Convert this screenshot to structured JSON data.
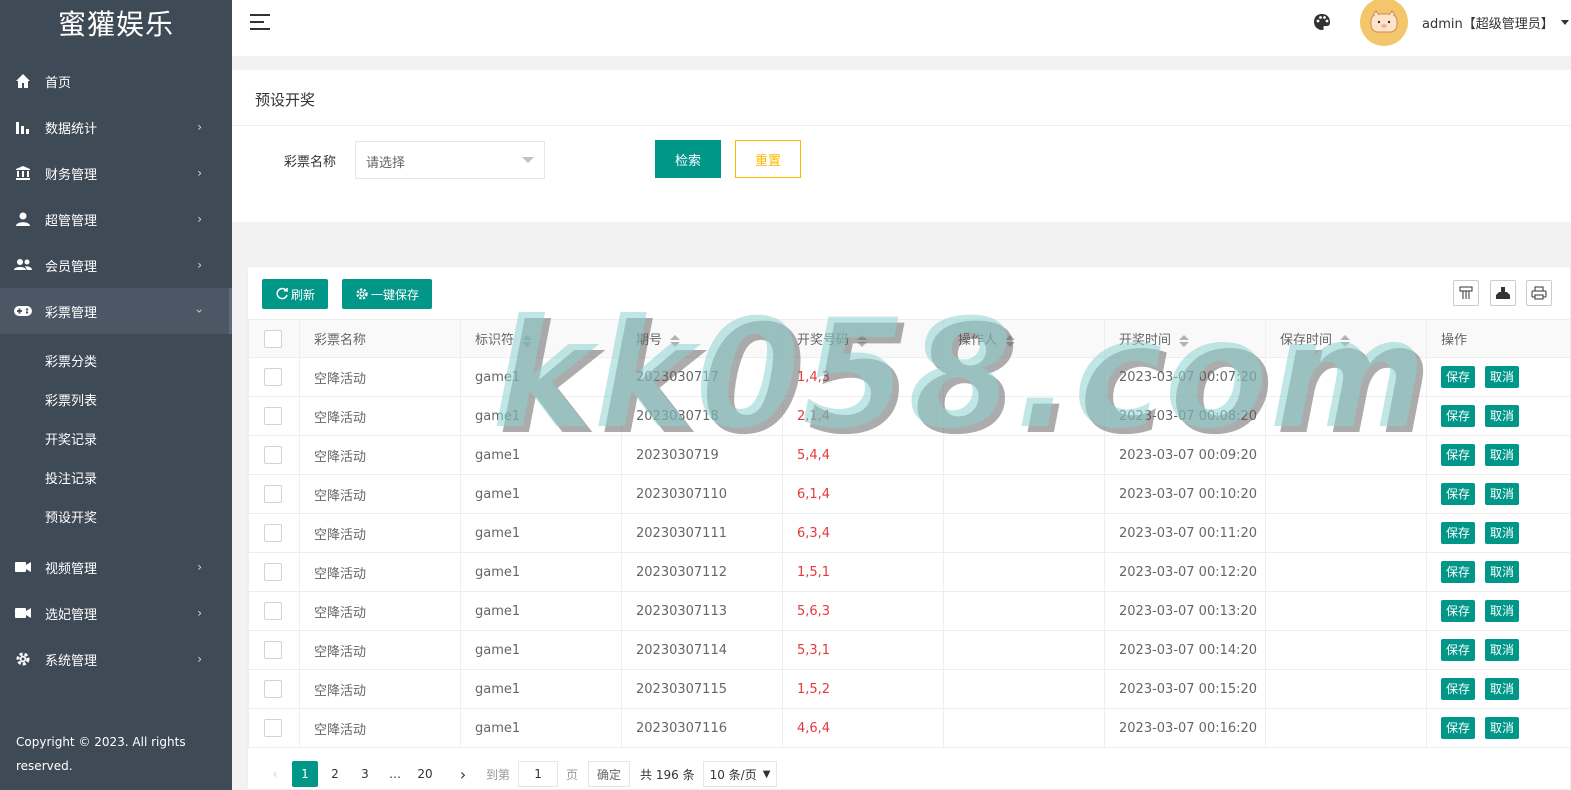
{
  "app": {
    "logo": "蜜獾娱乐",
    "copyright": "Copyright © 2023. All rights reserved."
  },
  "sidebar": {
    "items": [
      {
        "label": "首页",
        "icon": "home-icon"
      },
      {
        "label": "数据统计",
        "icon": "bar-chart-icon"
      },
      {
        "label": "财务管理",
        "icon": "bank-icon"
      },
      {
        "label": "超管管理",
        "icon": "user-icon"
      },
      {
        "label": "会员管理",
        "icon": "users-icon"
      },
      {
        "label": "彩票管理",
        "icon": "gamepad-icon",
        "expanded": true
      },
      {
        "label": "视频管理",
        "icon": "video-icon"
      },
      {
        "label": "选妃管理",
        "icon": "video-icon"
      },
      {
        "label": "系统管理",
        "icon": "gear-icon"
      }
    ],
    "sub_items": [
      "彩票分类",
      "彩票列表",
      "开奖记录",
      "投注记录",
      "预设开奖"
    ]
  },
  "header": {
    "user": "admin【超级管理员】"
  },
  "panel": {
    "title": "预设开奖",
    "field_label": "彩票名称",
    "select_placeholder": "请选择",
    "search_label": "检索",
    "reset_label": "重置"
  },
  "toolbar": {
    "refresh_label": "刷新",
    "save_all_label": "一键保存"
  },
  "table": {
    "columns": [
      "彩票名称",
      "标识符",
      "期号",
      "开奖号码",
      "操作人",
      "开奖时间",
      "保存时间",
      "操作"
    ],
    "save_label": "保存",
    "cancel_label": "取消",
    "rows": [
      {
        "name": "空降活动",
        "key": "game1",
        "issue": "2023030717",
        "numbers": "1,4,3",
        "operator": "",
        "draw_time": "2023-03-07 00:07:20",
        "save_time": ""
      },
      {
        "name": "空降活动",
        "key": "game1",
        "issue": "2023030718",
        "numbers": "2,1,4",
        "operator": "",
        "draw_time": "2023-03-07 00:08:20",
        "save_time": ""
      },
      {
        "name": "空降活动",
        "key": "game1",
        "issue": "2023030719",
        "numbers": "5,4,4",
        "operator": "",
        "draw_time": "2023-03-07 00:09:20",
        "save_time": ""
      },
      {
        "name": "空降活动",
        "key": "game1",
        "issue": "20230307110",
        "numbers": "6,1,4",
        "operator": "",
        "draw_time": "2023-03-07 00:10:20",
        "save_time": ""
      },
      {
        "name": "空降活动",
        "key": "game1",
        "issue": "20230307111",
        "numbers": "6,3,4",
        "operator": "",
        "draw_time": "2023-03-07 00:11:20",
        "save_time": ""
      },
      {
        "name": "空降活动",
        "key": "game1",
        "issue": "20230307112",
        "numbers": "1,5,1",
        "operator": "",
        "draw_time": "2023-03-07 00:12:20",
        "save_time": ""
      },
      {
        "name": "空降活动",
        "key": "game1",
        "issue": "20230307113",
        "numbers": "5,6,3",
        "operator": "",
        "draw_time": "2023-03-07 00:13:20",
        "save_time": ""
      },
      {
        "name": "空降活动",
        "key": "game1",
        "issue": "20230307114",
        "numbers": "5,3,1",
        "operator": "",
        "draw_time": "2023-03-07 00:14:20",
        "save_time": ""
      },
      {
        "name": "空降活动",
        "key": "game1",
        "issue": "20230307115",
        "numbers": "1,5,2",
        "operator": "",
        "draw_time": "2023-03-07 00:15:20",
        "save_time": ""
      },
      {
        "name": "空降活动",
        "key": "game1",
        "issue": "20230307116",
        "numbers": "4,6,4",
        "operator": "",
        "draw_time": "2023-03-07 00:16:20",
        "save_time": ""
      }
    ]
  },
  "pager": {
    "pages": [
      "1",
      "2",
      "3",
      "…",
      "20"
    ],
    "current": "1",
    "goto_label": "到第",
    "goto_value": "1",
    "page_label": "页",
    "confirm_label": "确定",
    "total_label": "共 196 条",
    "page_size": "10 条/页"
  },
  "watermark": "kk058.com",
  "colors": {
    "accent": "#009688",
    "warning": "#ffb800",
    "sidebar": "#3f4a57",
    "number_red": "#e4393c"
  }
}
